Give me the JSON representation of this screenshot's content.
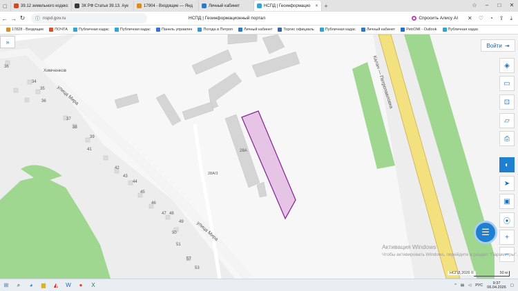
{
  "browser": {
    "tabs": [
      {
        "title": "39.12 земельного кодекс",
        "color": "#d04a26",
        "active": false
      },
      {
        "title": "ЗК РФ Статья 39.13. Аук",
        "color": "#3a3a3a",
        "active": false
      },
      {
        "title": "17904 - Входящие — Янд",
        "color": "#e08b18",
        "active": false
      },
      {
        "title": "Личный кабинет",
        "color": "#2a7bd0",
        "active": false
      },
      {
        "title": "НСПД | Геоинформацио",
        "color": "#2aa7d6",
        "active": true
      }
    ],
    "address": "nspd.gov.ru",
    "page_title": "НСПД | Геоинформационный портал",
    "alisa_label": "Спросить Алису AI",
    "bookmarks": [
      {
        "label": "17828 - Входящие",
        "color": "#e08b18"
      },
      {
        "label": "ПОЧТА",
        "color": "#e14d2a"
      },
      {
        "label": "Публичная кадас",
        "color": "#2aa7d6"
      },
      {
        "label": "Публичная кадас",
        "color": "#2aa7d6"
      },
      {
        "label": "Панель управлен",
        "color": "#3b6fd8"
      },
      {
        "label": "Погода в Петроп",
        "color": "#3596e0"
      },
      {
        "label": "Личный кабинет",
        "color": "#2a7bd0"
      },
      {
        "label": "Торгис официаль",
        "color": "#3366aa"
      },
      {
        "label": "Публичная кадас",
        "color": "#2aa7d6"
      },
      {
        "label": "Личный кабинет",
        "color": "#2a7bd0"
      },
      {
        "label": "PetrOMI - Outlook",
        "color": "#1d6fd2"
      },
      {
        "label": "Публичная кадас",
        "color": "#2aa7d6"
      }
    ]
  },
  "map": {
    "login_label": "Войти",
    "street_labels": {
      "mira_top": "улица Мира",
      "mira_bottom": "улица Мира",
      "himchenkov": "Химченков",
      "road": "Калач — Петропавловка"
    },
    "building_labels": [
      "28А",
      "28А/3"
    ],
    "house_numbers": [
      "36",
      "34",
      "35",
      "36",
      "37",
      "38",
      "39",
      "41",
      "42",
      "43",
      "44",
      "45",
      "46",
      "47",
      "48",
      "49",
      "50",
      "51",
      "57",
      "53"
    ],
    "watermark_title": "Активация Windows",
    "watermark_sub": "Чтобы активировать Windows, перейдите в раздел \"Параметры\".",
    "copyright": "НСПД 2026 ©",
    "scale_label": "50 м",
    "colors": {
      "parcel_fill": "#e5c4e6",
      "parcel_stroke": "#8b2b9a",
      "green": "#9fd690",
      "road": "#f3e07e"
    }
  },
  "taskbar": {
    "lang": "РУС",
    "time": "9:37",
    "date": "06.04.2026"
  }
}
